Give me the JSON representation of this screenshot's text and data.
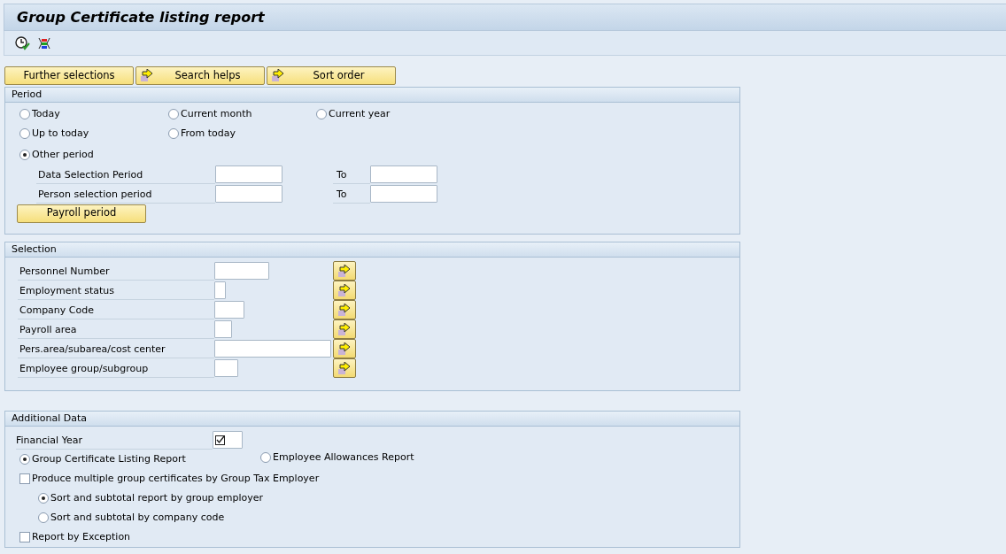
{
  "title": "Group Certificate listing report",
  "buttons": [
    {
      "label": "Further selections",
      "kind": "plain"
    },
    {
      "label": "Search helps",
      "kind": "arrow"
    },
    {
      "label": "Sort order",
      "kind": "arrow"
    }
  ],
  "period": {
    "title": "Period",
    "option_rows": [
      [
        {
          "label": "Today",
          "selected": false
        },
        {
          "label": "Current month",
          "selected": false
        },
        {
          "label": "Current year",
          "selected": false
        }
      ],
      [
        {
          "label": "Up to today",
          "selected": false
        },
        {
          "label": "From today",
          "selected": false
        }
      ],
      [
        {
          "label": "Other period",
          "selected": true
        }
      ]
    ],
    "fields": [
      {
        "label": "Data Selection Period",
        "to_label": "To"
      },
      {
        "label": "Person selection period",
        "to_label": "To"
      }
    ],
    "payroll_button": "Payroll period"
  },
  "selection": {
    "title": "Selection",
    "fields": [
      {
        "label": "Personnel Number"
      },
      {
        "label": "Employment status"
      },
      {
        "label": "Company Code"
      },
      {
        "label": "Payroll area"
      },
      {
        "label": "Pers.area/subarea/cost center"
      },
      {
        "label": "Employee group/subgroup"
      }
    ]
  },
  "additional": {
    "title": "Additional Data",
    "items": [
      {
        "kind": "field",
        "label": "Financial Year"
      },
      {
        "kind": "radios",
        "options": [
          {
            "label": "Group Certificate Listing Report",
            "selected": true
          },
          {
            "label": "Employee Allowances Report",
            "selected": false
          }
        ]
      },
      {
        "kind": "checkbox",
        "label": "Produce multiple group certificates by Group Tax Employer",
        "checked": false,
        "children": [
          {
            "label": "Sort and subtotal report by group employer",
            "selected": true
          },
          {
            "label": "Sort and subtotal by company code",
            "selected": false
          }
        ]
      },
      {
        "kind": "checkbox",
        "label": "Report by Exception",
        "checked": false
      }
    ]
  }
}
